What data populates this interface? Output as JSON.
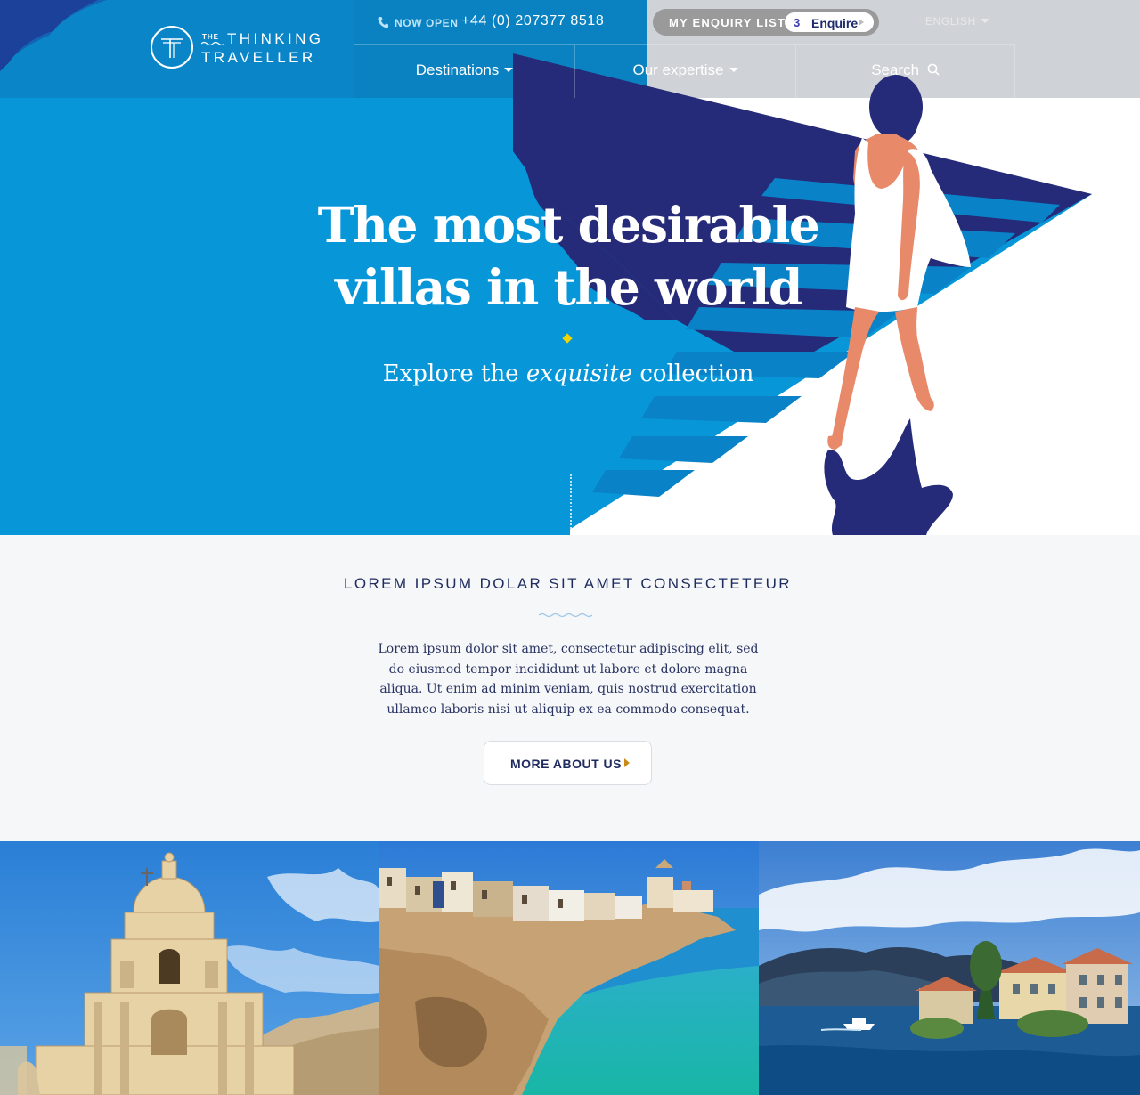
{
  "header": {
    "logo": {
      "the": "THE",
      "line1": "THINKING",
      "line2": "TRAVELLER"
    },
    "now_open": "NOW OPEN",
    "phone": "+44 (0) 207377 8518",
    "enquiry_label": "MY ENQUIRY LIST",
    "enquiry_count": "3",
    "enquire_button": "Enquire",
    "language": "ENGLISH",
    "nav": [
      {
        "label": "Destinations",
        "dropdown": true
      },
      {
        "label": "Our expertise",
        "dropdown": true
      },
      {
        "label": "Search",
        "icon": "search-icon"
      }
    ]
  },
  "hero": {
    "title_line1": "The most desirable",
    "title_line2": "villas in the world",
    "subtitle_before": "Explore the ",
    "subtitle_emphasis": "exquisite",
    "subtitle_after": " collection"
  },
  "intro": {
    "heading": "LOREM IPSUM DOLAR SIT AMET CONSECTETEUR",
    "body": "Lorem ipsum dolor sit amet, consectetur adipiscing elit, sed do eiusmod tempor incididunt ut labore et dolore magna aliqua. Ut enim ad minim veniam, quis nostrud exercitation ullamco laboris nisi ut aliquip ex ea commodo consequat.",
    "button": "MORE ABOUT US"
  },
  "colors": {
    "hero_blue": "#0797d9",
    "navy": "#252b78",
    "skin": "#e8896a",
    "text_navy": "#1e2b5e",
    "accent_yellow": "#f3d400"
  }
}
